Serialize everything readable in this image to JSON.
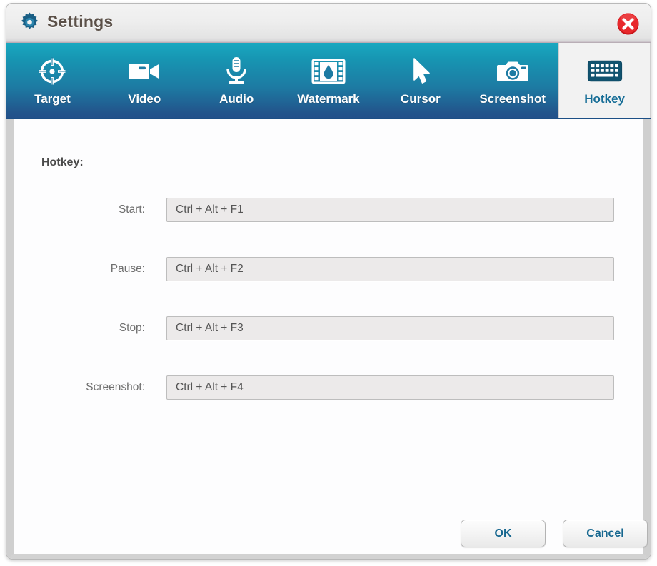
{
  "window": {
    "title": "Settings",
    "gear_icon": "gear-icon",
    "close_icon": "close-icon"
  },
  "theme": {
    "tabbar_top": "#19a8c0",
    "tabbar_bottom": "#23508a",
    "active_tab_bg": "#f2f2f2",
    "active_tab_text": "#176d96",
    "button_text": "#17678f",
    "close_button": "#e02020",
    "field_bg": "#eceaea",
    "label_text": "#6f6f6f"
  },
  "tabs": [
    {
      "label": "Target",
      "icon": "target-icon",
      "active": false
    },
    {
      "label": "Video",
      "icon": "video-camera-icon",
      "active": false
    },
    {
      "label": "Audio",
      "icon": "microphone-icon",
      "active": false
    },
    {
      "label": "Watermark",
      "icon": "watermark-icon",
      "active": false
    },
    {
      "label": "Cursor",
      "icon": "cursor-arrow-icon",
      "active": false
    },
    {
      "label": "Screenshot",
      "icon": "camera-icon",
      "active": false
    },
    {
      "label": "Hotkey",
      "icon": "keyboard-icon",
      "active": true
    }
  ],
  "panel": {
    "section_title": "Hotkey:",
    "rows": [
      {
        "label": "Start:",
        "value": "Ctrl + Alt + F1"
      },
      {
        "label": "Pause:",
        "value": "Ctrl + Alt + F2"
      },
      {
        "label": "Stop:",
        "value": "Ctrl + Alt + F3"
      },
      {
        "label": "Screenshot:",
        "value": "Ctrl + Alt + F4"
      }
    ]
  },
  "footer": {
    "ok_label": "OK",
    "cancel_label": "Cancel"
  }
}
